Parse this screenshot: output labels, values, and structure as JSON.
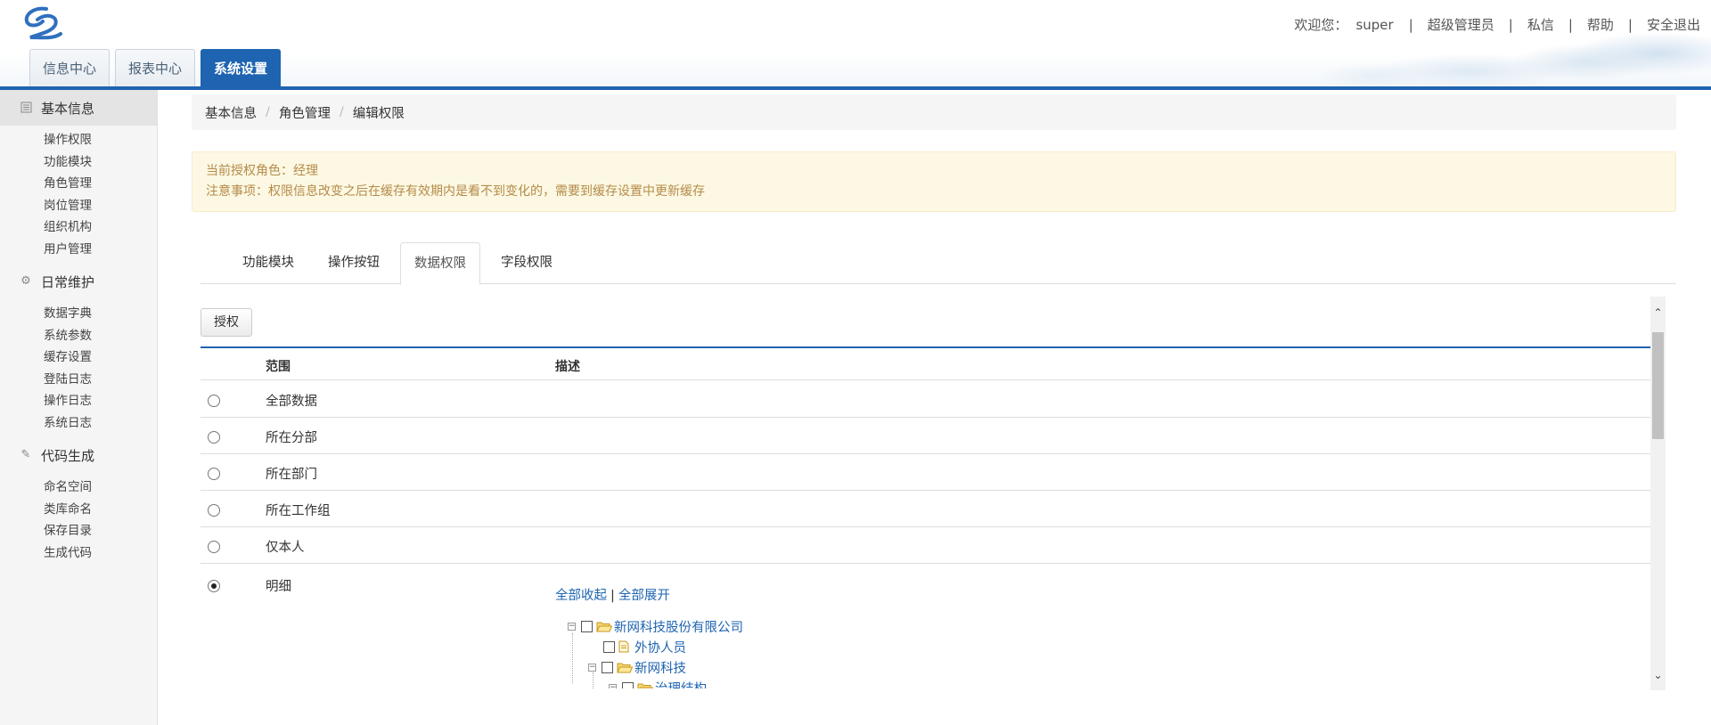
{
  "header": {
    "welcome": "欢迎您：",
    "user": "super",
    "links": [
      "超级管理员",
      "私信",
      "帮助",
      "安全退出"
    ]
  },
  "top_tabs": [
    {
      "label": "信息中心",
      "active": false
    },
    {
      "label": "报表中心",
      "active": false
    },
    {
      "label": "系统设置",
      "active": true
    }
  ],
  "sidebar": {
    "groups": [
      {
        "title": "基本信息",
        "icon": "list-icon",
        "items": [
          "操作权限",
          "功能模块",
          "角色管理",
          "岗位管理",
          "组织机构",
          "用户管理"
        ]
      },
      {
        "title": "日常维护",
        "icon": "gear-icon",
        "items": [
          "数据字典",
          "系统参数",
          "缓存设置",
          "登陆日志",
          "操作日志",
          "系统日志"
        ]
      },
      {
        "title": "代码生成",
        "icon": "pencil-icon",
        "items": [
          "命名空间",
          "类库命名",
          "保存目录",
          "生成代码"
        ]
      }
    ]
  },
  "breadcrumb": [
    "基本信息",
    "角色管理",
    "编辑权限"
  ],
  "alert": {
    "line1": "当前授权角色：经理",
    "line2": "注意事项：权限信息改变之后在缓存有效期内是看不到变化的，需要到缓存设置中更新缓存"
  },
  "perm_tabs": [
    {
      "label": "功能模块",
      "active": false
    },
    {
      "label": "操作按钮",
      "active": false
    },
    {
      "label": "数据权限",
      "active": true
    },
    {
      "label": "字段权限",
      "active": false
    }
  ],
  "grid": {
    "auth_button": "授权",
    "columns": [
      "范围",
      "描述"
    ],
    "rows": [
      "全部数据",
      "所在分部",
      "所在部门",
      "所在工作组",
      "仅本人",
      "明细"
    ],
    "selected": "明细"
  },
  "tree": {
    "collapse_all": "全部收起",
    "separator": "|",
    "expand_all": "全部展开",
    "nodes": [
      "新网科技股份有限公司",
      "外协人员",
      "新网科技",
      "治理结构"
    ]
  },
  "colors": {
    "brand": "#1e64b0",
    "alert_text": "#b58b4a",
    "alert_bg": "#fcf8e3"
  }
}
